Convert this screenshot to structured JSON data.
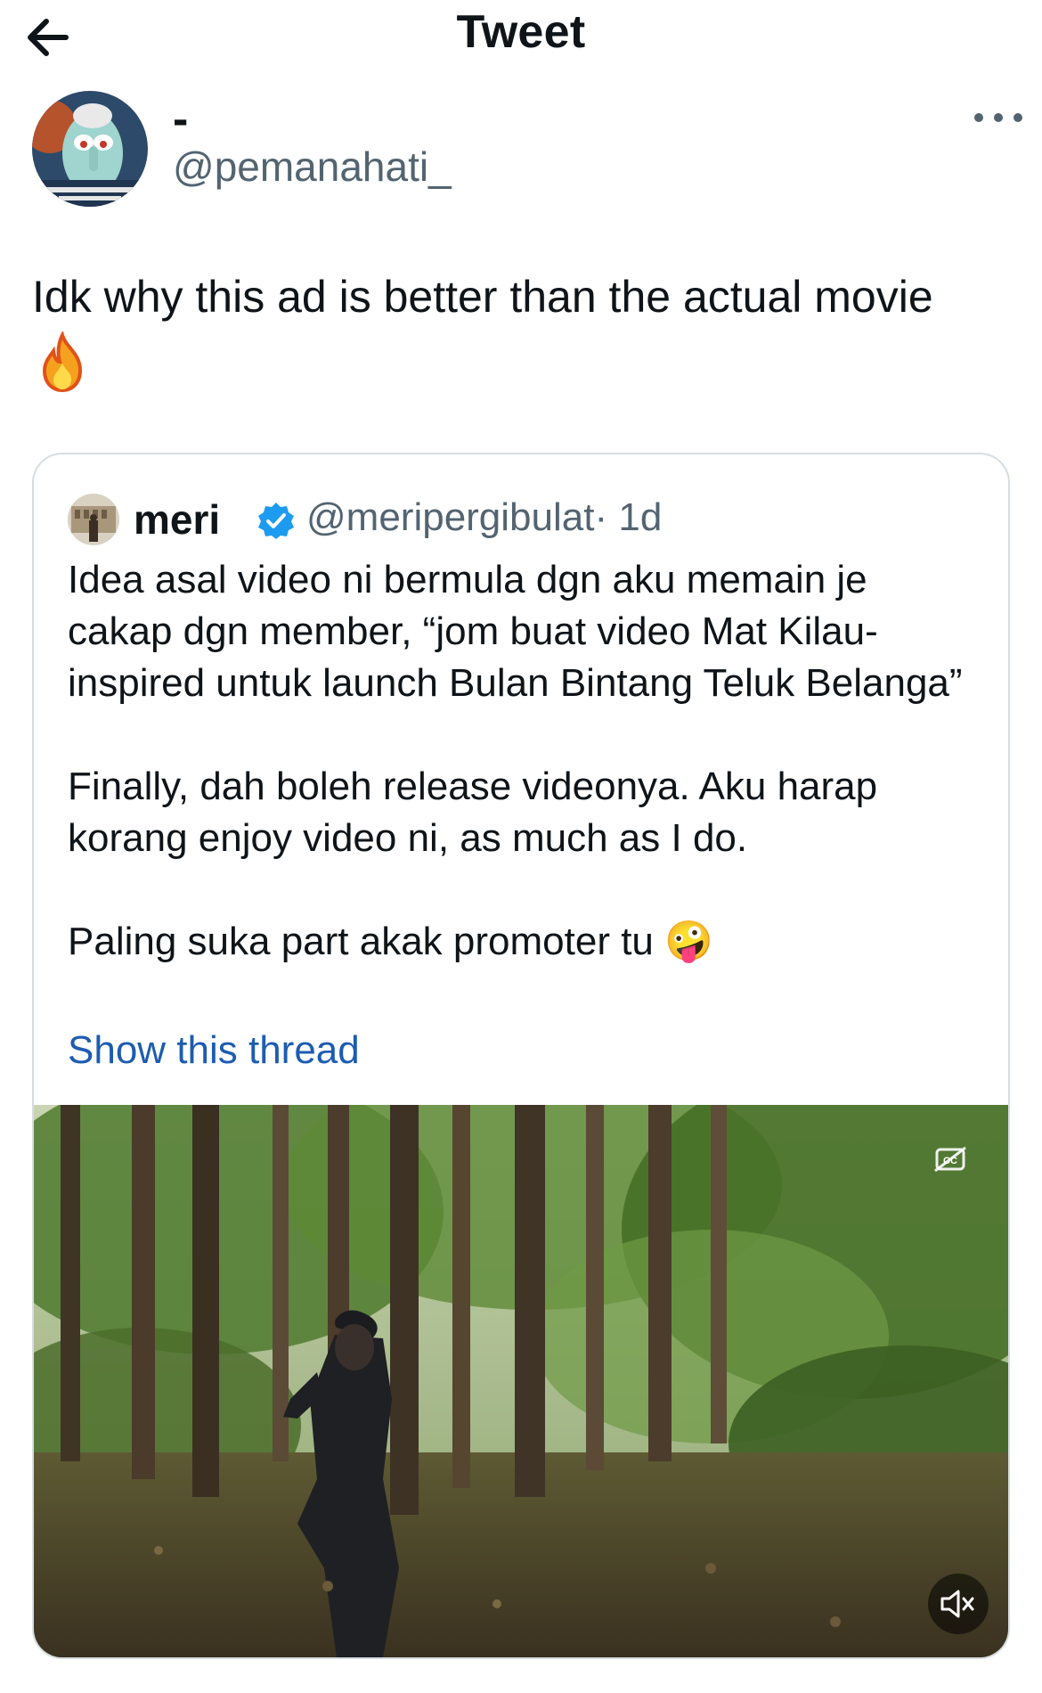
{
  "header": {
    "title": "Tweet",
    "back_icon": "arrow-left-icon"
  },
  "tweet": {
    "author": {
      "display_name": "-",
      "handle": "@pemanahati_"
    },
    "more_icon": "more-options-icon",
    "text": "Idk why this ad is better than the actual movie",
    "emoji": "🔥"
  },
  "quoted_tweet": {
    "author": {
      "display_name": "meri",
      "handle": "@meripergibulat",
      "time": "· 1d",
      "verified": true
    },
    "paragraphs": [
      "Idea asal video ni bermula dgn aku memain je cakap dgn member, “jom buat video Mat Kilau-inspired untuk launch Bulan Bintang Teluk Belanga”",
      "Finally, dah boleh release videonya. Aku harap korang enjoy video ni, as much as I do.",
      "Paling suka part akak promoter tu 🤪"
    ],
    "show_thread": "Show this thread",
    "video": {
      "captions_icon": "captions-off-icon",
      "mute_icon": "muted-speaker-icon"
    }
  },
  "colors": {
    "link": "#1d5cb0",
    "secondary": "#536471",
    "border": "#d7dde2",
    "verified": "#1d9bf0"
  }
}
